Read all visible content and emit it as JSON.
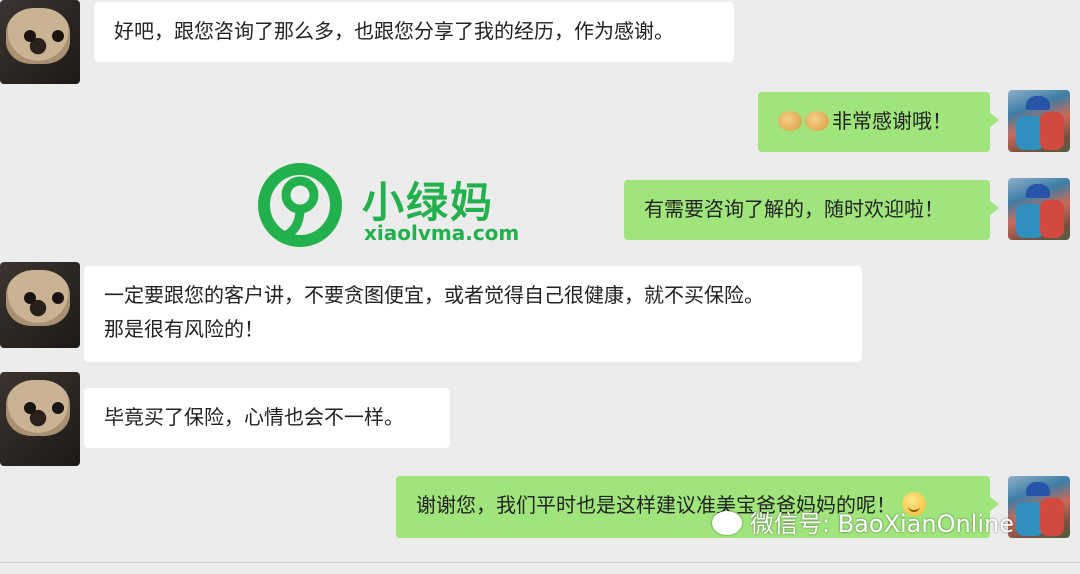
{
  "messages": [
    {
      "side": "left",
      "text": "好吧，跟您咨询了那么多，也跟您分享了我的经历，作为感谢。"
    },
    {
      "side": "right",
      "text": "非常感谢哦！",
      "emoji_before": [
        "handshake-icon",
        "handshake-icon"
      ]
    },
    {
      "side": "right",
      "text": "有需要咨询了解的，随时欢迎啦！"
    },
    {
      "side": "left",
      "text_lines": [
        "一定要跟您的客户讲，不要贪图便宜，或者觉得自己很健康，就不买保险。",
        "那是很有风险的！"
      ]
    },
    {
      "side": "left",
      "text": "毕竟买了保险，心情也会不一样。"
    },
    {
      "side": "right",
      "text": "谢谢您，我们平时也是这样建议准美宝爸爸妈妈的呢！",
      "emoji_after": "smile-icon"
    }
  ],
  "logo": {
    "cn": "小绿妈",
    "en": "xiaolvma.com",
    "color": "#22b14c"
  },
  "watermark": {
    "text": "微信号: BaoXianOnline",
    "icon": "wechat-icon"
  },
  "colors": {
    "background": "#ececec",
    "left_bubble": "#ffffff",
    "right_bubble": "#9fe57b"
  }
}
